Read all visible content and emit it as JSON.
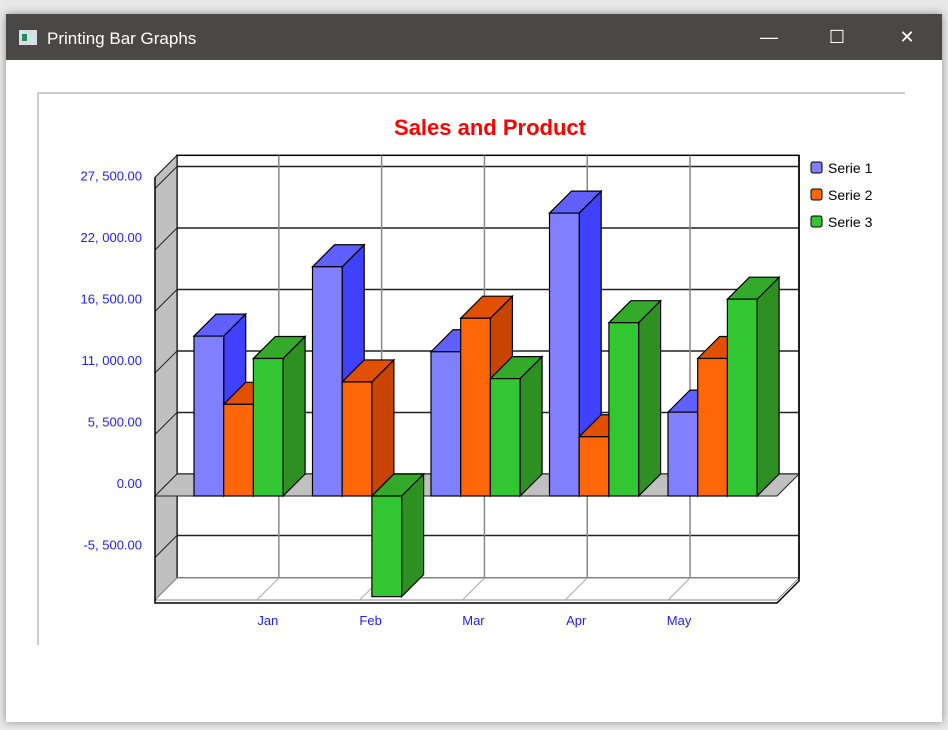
{
  "window": {
    "title": "Printing Bar Graphs",
    "minimize": "—",
    "maximize": "☐",
    "close": "✕"
  },
  "chart_data": {
    "type": "bar",
    "title": "Sales and Product",
    "categories": [
      "Jan",
      "Feb",
      "Mar",
      "Apr",
      "May"
    ],
    "series": [
      {
        "name": "Serie 1",
        "values": [
          14300,
          20500,
          12900,
          25300,
          7500
        ],
        "color": "#8080ff",
        "side": "#4040ff",
        "top": "#6060ff"
      },
      {
        "name": "Serie 2",
        "values": [
          8200,
          10200,
          15900,
          5300,
          12300
        ],
        "color": "#ff6608",
        "side": "#c84400",
        "top": "#e05000"
      },
      {
        "name": "Serie 3",
        "values": [
          12300,
          -9000,
          10500,
          15500,
          17600
        ],
        "color": "#33c633",
        "side": "#2e8f22",
        "top": "#33aa2a"
      }
    ],
    "yticks": [
      "27, 500.00",
      "22, 000.00",
      "16, 500.00",
      "11, 000.00",
      "5, 500.00",
      "0.00",
      "-5, 500.00"
    ],
    "ytick_values": [
      27500,
      22000,
      16500,
      11000,
      5500,
      0,
      -5500
    ],
    "ylim": [
      -9300,
      28500
    ],
    "grid": true,
    "legend": "right",
    "title_color": "#ff0000",
    "tick_color": "#2020ff"
  }
}
